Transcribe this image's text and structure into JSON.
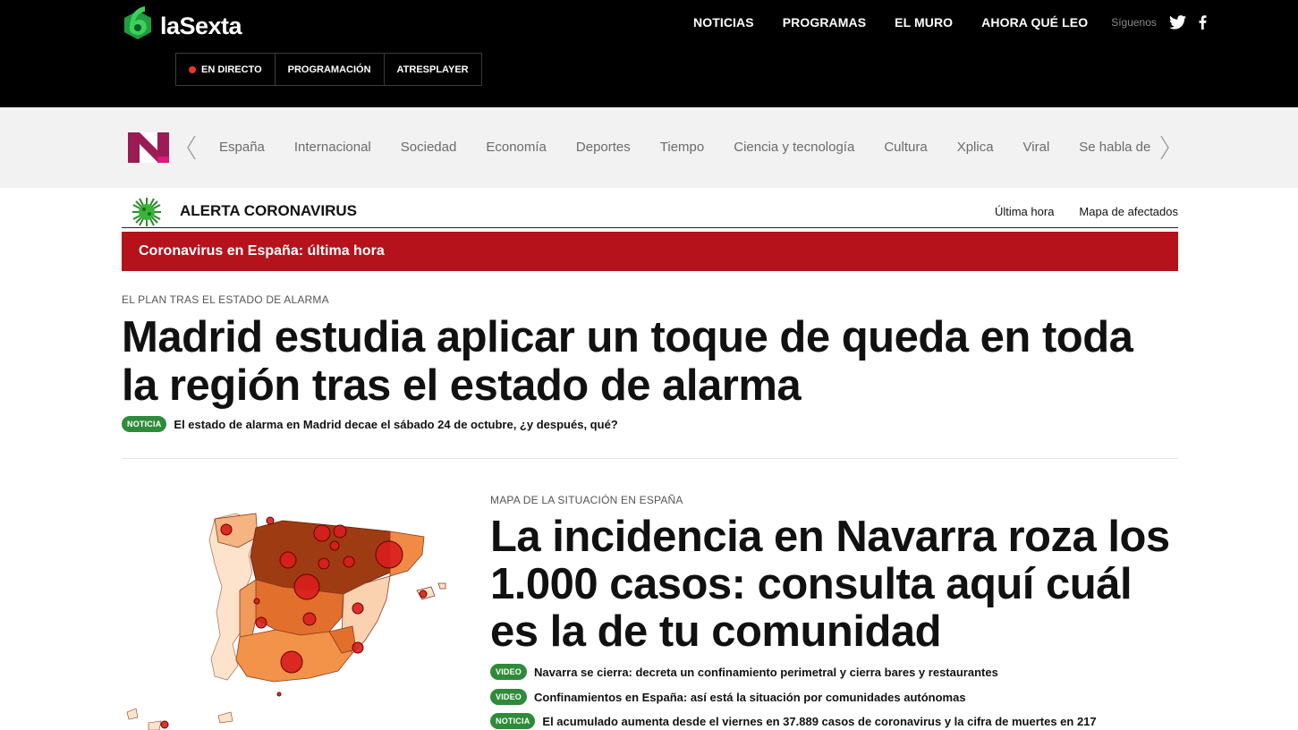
{
  "brand": {
    "name": "laSexta"
  },
  "header": {
    "nav": [
      "NOTICIAS",
      "PROGRAMAS",
      "EL MURO",
      "AHORA QUÉ LEO"
    ],
    "follow_label": "Síguenos",
    "social_icons": [
      "twitter-icon",
      "facebook-icon"
    ],
    "subnav": {
      "live": "EN DIRECTO",
      "schedule": "PROGRAMACIÓN",
      "player": "ATRESPLAYER"
    }
  },
  "sections": [
    "España",
    "Internacional",
    "Sociedad",
    "Economía",
    "Deportes",
    "Tiempo",
    "Ciencia y tecnología",
    "Cultura",
    "Xplica",
    "Viral",
    "Se habla de"
  ],
  "alert": {
    "title": "ALERTA CORONAVIRUS",
    "links": [
      "Última hora",
      "Mapa de afectados"
    ],
    "banner": "Coronavirus en España: última hora"
  },
  "lead": {
    "kicker": "EL PLAN TRAS EL ESTADO DE ALARMA",
    "headline": "Madrid estudia aplicar un toque de queda en toda la región tras el estado de alarma",
    "related": {
      "tag": "NOTICIA",
      "text": "El estado de alarma en Madrid decae el sábado 24 de octubre, ¿y después, qué?"
    }
  },
  "second": {
    "kicker": "MAPA DE LA SITUACIÓN EN ESPAÑA",
    "headline": "La incidencia en Navarra roza los 1.000 casos: consulta aquí cuál es la de tu comunidad",
    "related": [
      {
        "tag": "VIDEO",
        "text": "Navarra se cierra: decreta un confinamiento perimetral y cierra bares y restaurantes"
      },
      {
        "tag": "VIDEO",
        "text": "Confinamientos en España: así está la situación por comunidades autónomas"
      },
      {
        "tag": "NOTICIA",
        "text": "El acumulado aumenta desde el viernes en 37.889 casos de coronavirus y la cifra de muertes en 217"
      }
    ]
  },
  "colors": {
    "header_bg": "#000000",
    "alert_red": "#b5121b",
    "tag_green": "#2e8b3a",
    "brand_green": "#1f9e3f"
  }
}
